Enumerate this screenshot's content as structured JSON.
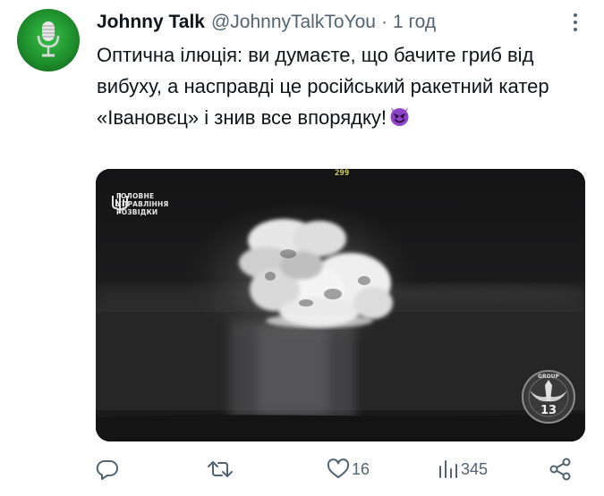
{
  "tweet": {
    "author_name": "Johnny Talk",
    "handle": "@JohnnyTalkToYou",
    "separator": "·",
    "time": "1 год",
    "text": "Оптична ілюція: ви думаєте, що бачите гриб від вибуху, а насправді це російський ракетний катер «Івановєц» і знив все впорядку!",
    "emoji": "smiling-devil-emoji",
    "avatar_icon": "microphone-icon"
  },
  "media": {
    "logo_text_lines": [
      "ГОЛОВНЕ",
      "УПРАВЛІННЯ",
      "РОЗВІДКИ"
    ],
    "osd_number": "299",
    "badge_top_text": "GROUP",
    "badge_number": "13"
  },
  "actions": {
    "reply_count": "",
    "retweet_count": "",
    "like_count": "16",
    "view_count": "345"
  },
  "colors": {
    "text_primary": "#0f1419",
    "text_secondary": "#536471",
    "avatar_green": "#1f8f2c",
    "emoji_purple": "#8e44c9"
  }
}
